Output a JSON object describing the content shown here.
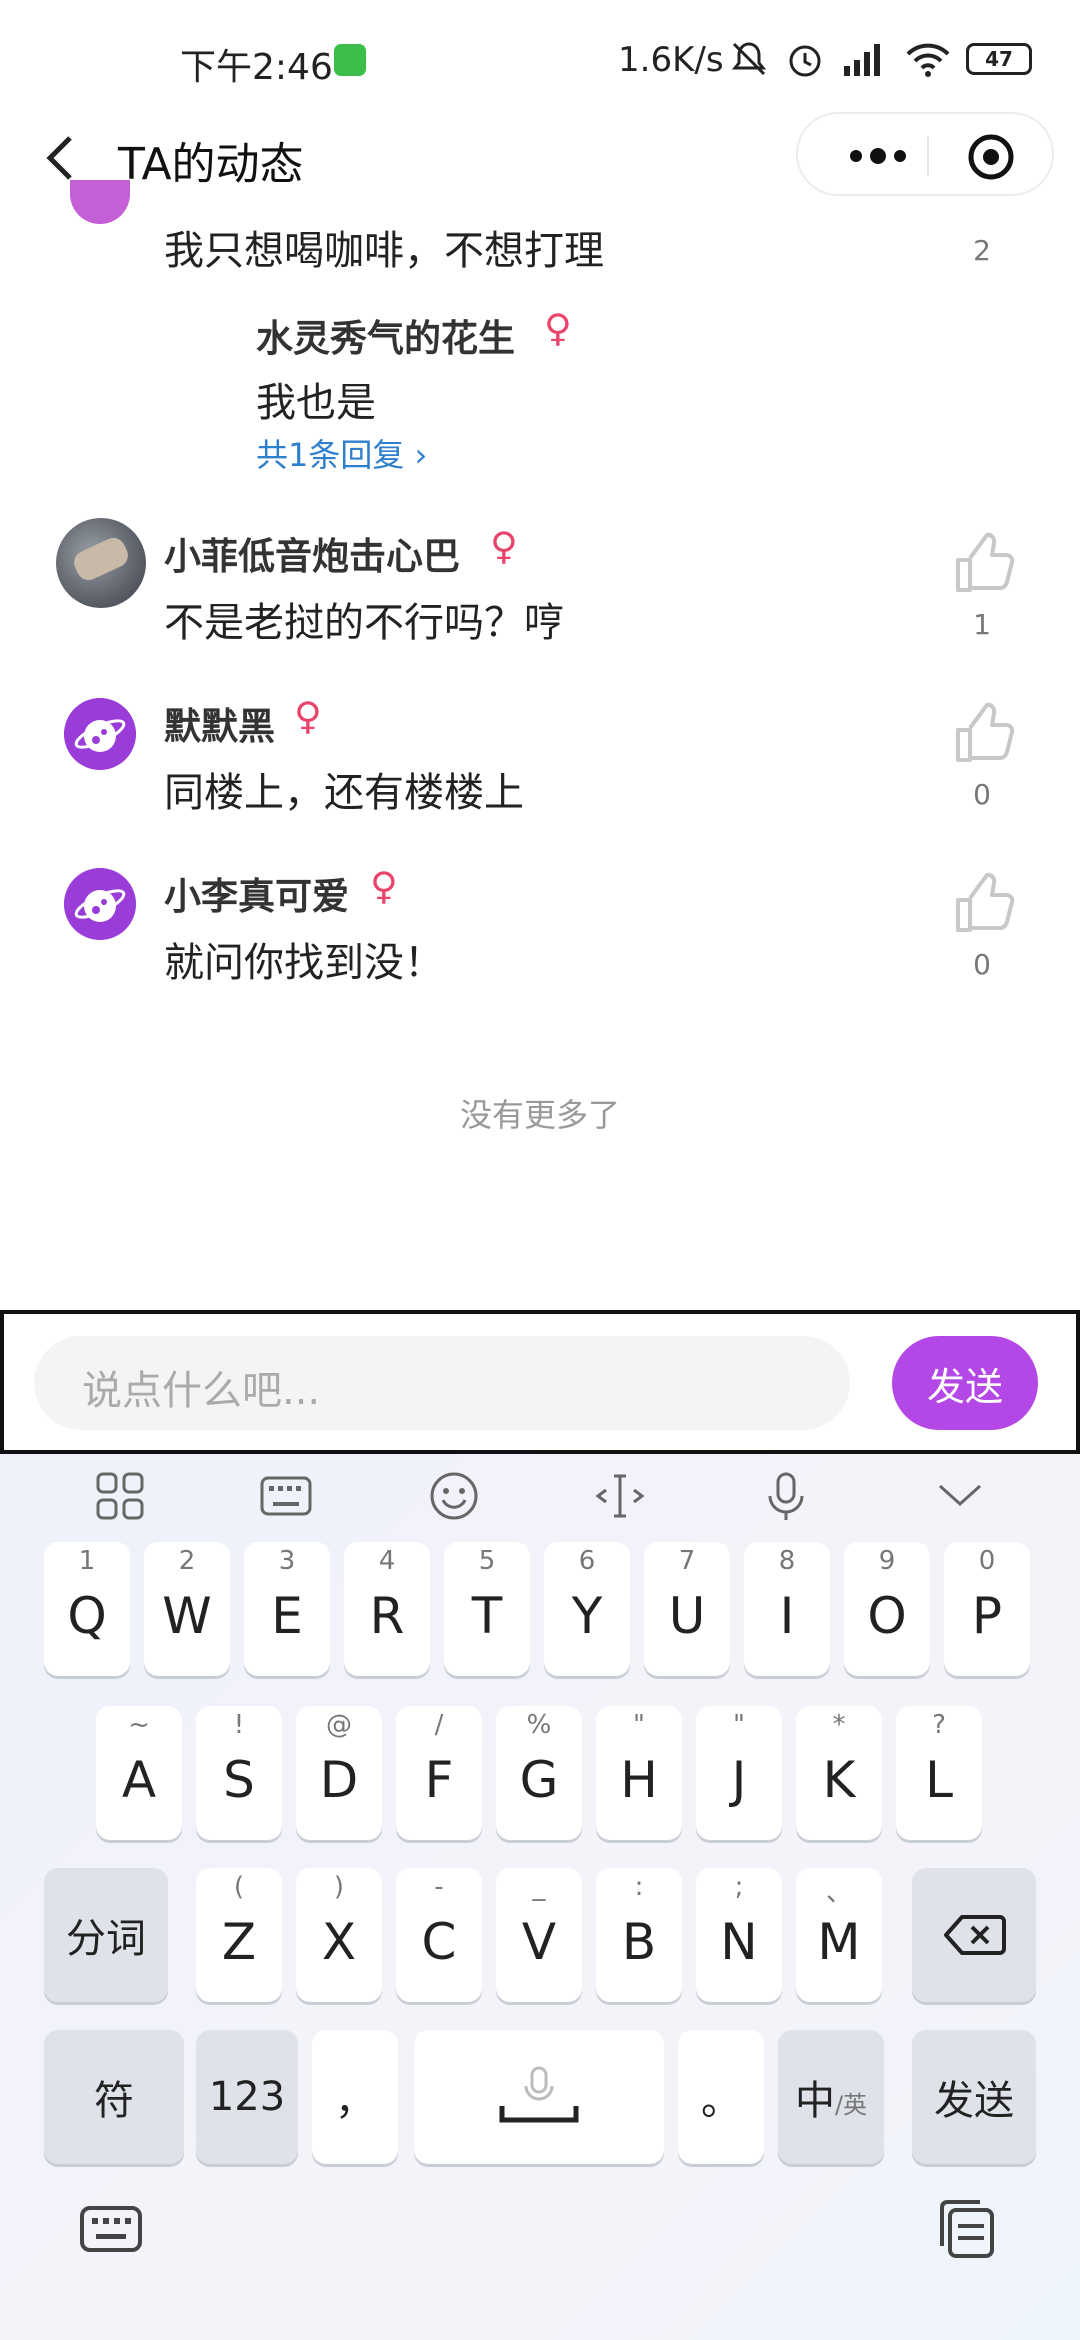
{
  "status_bar": {
    "time": "下午2:46",
    "speed": "1.6K/s",
    "battery": "47"
  },
  "header": {
    "title": "TA的动态"
  },
  "comments": {
    "first_text": "我只想喝咖啡，不想打理",
    "first_likes": "2",
    "reply": {
      "name": "水灵秀气的花生",
      "gender": "♀",
      "text": "我也是",
      "more": "共1条回复 ›"
    },
    "items": [
      {
        "name": "小菲低音炮击心巴",
        "gender": "♀",
        "text": "不是老挝的不行吗？哼",
        "likes": "1"
      },
      {
        "name": "默默黑",
        "gender": "♀",
        "text": "同楼上，还有楼楼上",
        "likes": "0"
      },
      {
        "name": "小李真可爱",
        "gender": "♀",
        "text": "就问你找到没！",
        "likes": "0"
      }
    ],
    "end_text": "没有更多了"
  },
  "input": {
    "placeholder": "说点什么吧...",
    "send_label": "发送"
  },
  "keyboard": {
    "row1": [
      {
        "k": "Q",
        "s": "1"
      },
      {
        "k": "W",
        "s": "2"
      },
      {
        "k": "E",
        "s": "3"
      },
      {
        "k": "R",
        "s": "4"
      },
      {
        "k": "T",
        "s": "5"
      },
      {
        "k": "Y",
        "s": "6"
      },
      {
        "k": "U",
        "s": "7"
      },
      {
        "k": "I",
        "s": "8"
      },
      {
        "k": "O",
        "s": "9"
      },
      {
        "k": "P",
        "s": "0"
      }
    ],
    "row2": [
      {
        "k": "A",
        "s": "~"
      },
      {
        "k": "S",
        "s": "!"
      },
      {
        "k": "D",
        "s": "@"
      },
      {
        "k": "F",
        "s": "/"
      },
      {
        "k": "G",
        "s": "%"
      },
      {
        "k": "H",
        "s": "\""
      },
      {
        "k": "J",
        "s": "\""
      },
      {
        "k": "K",
        "s": "*"
      },
      {
        "k": "L",
        "s": "?"
      }
    ],
    "row3": [
      {
        "k": "Z",
        "s": "("
      },
      {
        "k": "X",
        "s": ")"
      },
      {
        "k": "C",
        "s": "-"
      },
      {
        "k": "V",
        "s": "_"
      },
      {
        "k": "B",
        "s": ":"
      },
      {
        "k": "N",
        "s": ";"
      },
      {
        "k": "M",
        "s": "、"
      }
    ],
    "fenci": "分词",
    "fu": "符",
    "num": "123",
    "comma": "，",
    "period": "。",
    "zh": "中",
    "zh_sub": "/英",
    "send": "发送"
  }
}
